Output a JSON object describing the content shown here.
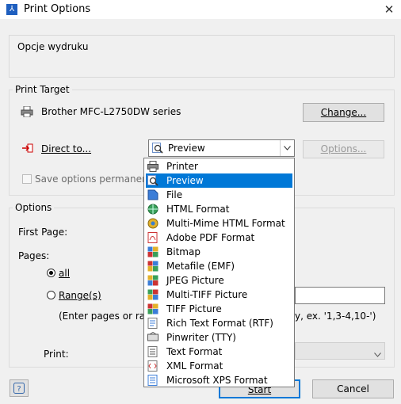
{
  "window": {
    "title": "Print Options",
    "close_glyph": "✕",
    "app_icon": "pdf-app-icon"
  },
  "header": {
    "description": "Opcje wydruku"
  },
  "print_target": {
    "group_label": "Print Target",
    "printer_name": "Brother MFC-L2750DW series",
    "change_button": "Change...",
    "direct_to_label": "Direct to...",
    "direct_to_value": "Preview",
    "options_button": "Options...",
    "save_options_label": "Save options permanently",
    "save_options_checked": false
  },
  "dropdown": {
    "selected_index": 1,
    "items": [
      {
        "label": "Printer",
        "icon": "printer-icon"
      },
      {
        "label": "Preview",
        "icon": "preview-icon"
      },
      {
        "label": "File",
        "icon": "file-icon"
      },
      {
        "label": "HTML Format",
        "icon": "html-icon"
      },
      {
        "label": "Multi-Mime HTML Format",
        "icon": "mime-html-icon"
      },
      {
        "label": "Adobe PDF Format",
        "icon": "pdf-icon"
      },
      {
        "label": "Bitmap",
        "icon": "bitmap-icon"
      },
      {
        "label": "Metafile (EMF)",
        "icon": "metafile-icon"
      },
      {
        "label": "JPEG Picture",
        "icon": "jpeg-icon"
      },
      {
        "label": "Multi-TIFF Picture",
        "icon": "multi-tiff-icon"
      },
      {
        "label": "TIFF Picture",
        "icon": "tiff-icon"
      },
      {
        "label": "Rich Text Format (RTF)",
        "icon": "rtf-icon"
      },
      {
        "label": "Pinwriter (TTY)",
        "icon": "pinwriter-icon"
      },
      {
        "label": "Text Format",
        "icon": "text-icon"
      },
      {
        "label": "XML Format",
        "icon": "xml-icon"
      },
      {
        "label": "Microsoft XPS Format",
        "icon": "xps-icon"
      }
    ]
  },
  "options": {
    "group_label": "Options",
    "first_page_label": "First Page:",
    "pages_label": "Pages:",
    "all_label": "all",
    "all_selected": true,
    "range_label": "Range(s)",
    "range_hint_left": "(Enter pages or ranges",
    "range_hint_right": "y, ex. '1,3-4,10-')",
    "print_label": "Print:"
  },
  "footer": {
    "help_icon": "help-icon",
    "start_button": "Start",
    "cancel_button": "Cancel"
  },
  "colors": {
    "selection": "#0078d7",
    "window_bg": "#f0f0f0"
  }
}
